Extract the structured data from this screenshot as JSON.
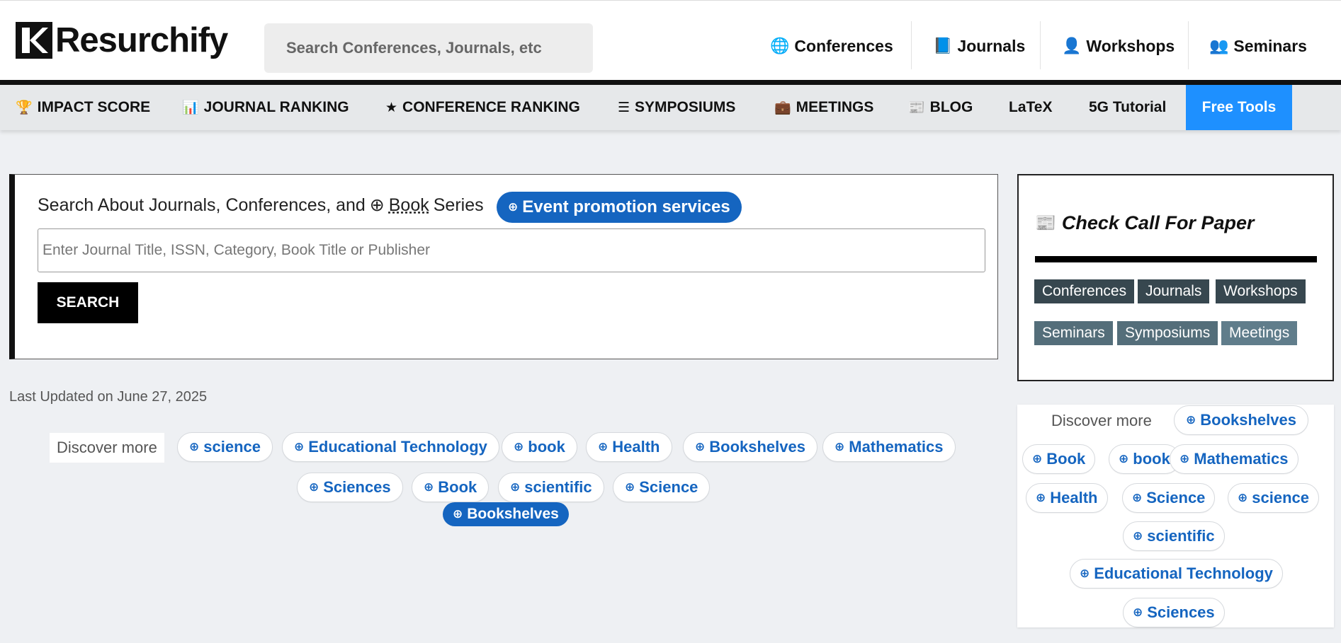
{
  "header": {
    "logo_text": "Resurchify",
    "search_placeholder": "Search Conferences, Journals, etc",
    "nav": [
      {
        "label": "Conferences",
        "icon": "globe-icon",
        "glyph": "🌐"
      },
      {
        "label": "Journals",
        "icon": "book-icon",
        "glyph": "📘"
      },
      {
        "label": "Workshops",
        "icon": "user-icon",
        "glyph": "👤"
      },
      {
        "label": "Seminars",
        "icon": "users-icon",
        "glyph": "👥"
      }
    ]
  },
  "subnav": [
    {
      "label": "IMPACT SCORE",
      "icon": "trophy-icon",
      "glyph": "🏆"
    },
    {
      "label": "JOURNAL RANKING",
      "icon": "bar-chart-icon",
      "glyph": "📊"
    },
    {
      "label": "CONFERENCE RANKING",
      "icon": "star-icon",
      "glyph": "★"
    },
    {
      "label": "SYMPOSIUMS",
      "icon": "list-icon",
      "glyph": "☰"
    },
    {
      "label": "MEETINGS",
      "icon": "briefcase-icon",
      "glyph": "💼"
    },
    {
      "label": "BLOG",
      "icon": "newspaper-icon",
      "glyph": "📰"
    },
    {
      "label": "LaTeX",
      "icon": "",
      "glyph": ""
    },
    {
      "label": "5G Tutorial",
      "icon": "",
      "glyph": ""
    },
    {
      "label": "Free Tools",
      "icon": "",
      "glyph": ""
    }
  ],
  "search_card": {
    "title_prefix": "Search About Journals, Conferences, and",
    "title_book": "Book",
    "title_suffix": "Series",
    "promo": "Event promotion services",
    "input_placeholder": "Enter Journal Title, ISSN, Category, Book Title or Publisher",
    "button": "SEARCH"
  },
  "cfp": {
    "title": "Check Call For Paper",
    "tags": [
      "Conferences",
      "Journals",
      "Workshops",
      "Seminars",
      "Symposiums",
      "Meetings"
    ]
  },
  "last_updated": "Last Updated on June 27, 2025",
  "discover_main": {
    "label": "Discover more",
    "chips": [
      "science",
      "Educational Technology",
      "book",
      "Health",
      "Bookshelves",
      "Mathematics",
      "Sciences",
      "Book",
      "scientific",
      "Science"
    ],
    "active_chip": "Bookshelves"
  },
  "discover_side": {
    "label": "Discover more",
    "chips": [
      "Bookshelves",
      "Book",
      "book",
      "Mathematics",
      "Health",
      "Science",
      "science",
      "scientific",
      "Educational Technology",
      "Sciences"
    ]
  },
  "colors": {
    "accent": "#1565c0",
    "free_tools_bg": "#1e90ff",
    "tag_dark": "#37474f"
  }
}
